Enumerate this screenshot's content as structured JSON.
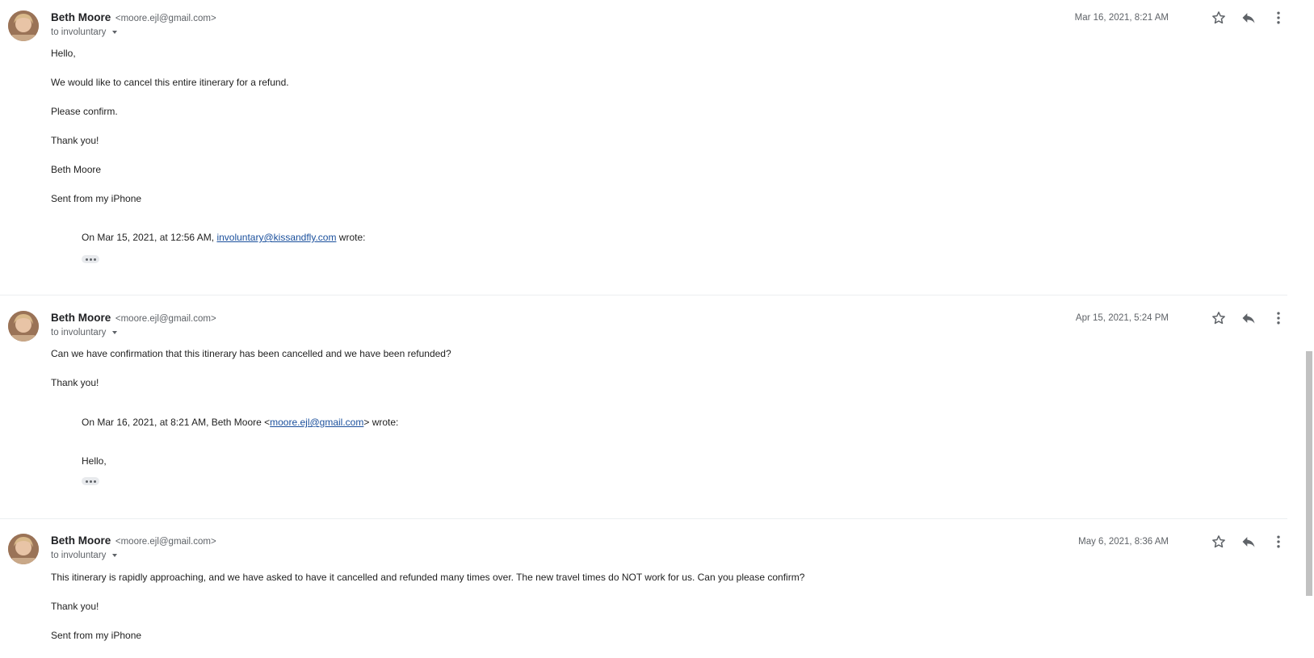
{
  "messages": [
    {
      "sender_name": "Beth Moore",
      "sender_email": "<moore.ejl@gmail.com>",
      "to": "to involuntary",
      "date": "Mar 16, 2021, 8:21 AM",
      "body": [
        "Hello,",
        "We would like to cancel this entire itinerary for a refund.",
        "Please confirm.",
        "Thank you!",
        "Beth Moore",
        "Sent from my iPhone"
      ],
      "quote_prefix": "On Mar 15, 2021, at 12:56 AM, ",
      "quote_link": "involuntary@kissandfly.com",
      "quote_suffix": " wrote:"
    },
    {
      "sender_name": "Beth Moore",
      "sender_email": "<moore.ejl@gmail.com>",
      "to": "to involuntary",
      "date": "Apr 15, 2021, 5:24 PM",
      "body": [
        "Can we have confirmation that this itinerary has been cancelled and we have been refunded?",
        "Thank you!"
      ],
      "quote_prefix": "On Mar 16, 2021, at 8:21 AM, Beth Moore <",
      "quote_link": "moore.ejl@gmail.com",
      "quote_suffix": "> wrote:",
      "quote_body": "Hello,"
    },
    {
      "sender_name": "Beth Moore",
      "sender_email": "<moore.ejl@gmail.com>",
      "to": "to involuntary",
      "date": "May 6, 2021, 8:36 AM",
      "body": [
        "This itinerary is rapidly approaching, and we have asked to have it cancelled and refunded many times over. The new travel times do NOT work for us. Can you please confirm?",
        "Thank you!",
        "Sent from my iPhone"
      ]
    }
  ],
  "icons": {
    "star": "star-icon",
    "reply": "reply-icon",
    "more": "more-vert-icon",
    "expand": "ellipsis-icon"
  }
}
